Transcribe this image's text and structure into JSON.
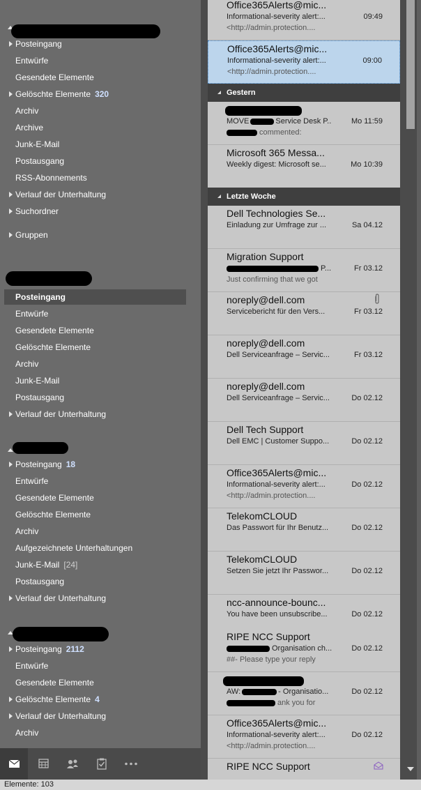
{
  "sidebar": {
    "account1": {
      "folders": [
        {
          "label": "Posteingang",
          "arrow": "collapsed",
          "count": ""
        },
        {
          "label": "Entwürfe",
          "arrow": "",
          "count": ""
        },
        {
          "label": "Gesendete Elemente",
          "arrow": "",
          "count": ""
        },
        {
          "label": "Gelöschte Elemente",
          "arrow": "collapsed",
          "count": "320"
        },
        {
          "label": "Archiv",
          "arrow": "",
          "count": ""
        },
        {
          "label": "Archive",
          "arrow": "",
          "count": ""
        },
        {
          "label": "Junk-E-Mail",
          "arrow": "",
          "count": ""
        },
        {
          "label": "Postausgang",
          "arrow": "",
          "count": ""
        },
        {
          "label": "RSS-Abonnements",
          "arrow": "",
          "count": ""
        },
        {
          "label": "Verlauf der Unterhaltung",
          "arrow": "collapsed",
          "count": ""
        },
        {
          "label": "Suchordner",
          "arrow": "collapsed",
          "count": ""
        }
      ],
      "groups": "Gruppen"
    },
    "account2": {
      "folders": [
        {
          "label": "Posteingang",
          "selected": true
        },
        {
          "label": "Entwürfe"
        },
        {
          "label": "Gesendete Elemente"
        },
        {
          "label": "Gelöschte Elemente"
        },
        {
          "label": "Archiv"
        },
        {
          "label": "Junk-E-Mail"
        },
        {
          "label": "Postausgang"
        },
        {
          "label": "Verlauf der Unterhaltung"
        }
      ]
    },
    "account3": {
      "folders": [
        {
          "label": "Posteingang",
          "count": "18"
        },
        {
          "label": "Entwürfe"
        },
        {
          "label": "Gesendete Elemente"
        },
        {
          "label": "Gelöschte Elemente"
        },
        {
          "label": "Archiv"
        },
        {
          "label": "Aufgezeichnete Unterhaltungen"
        },
        {
          "label": "Junk-E-Mail",
          "count": "[24]"
        },
        {
          "label": "Postausgang"
        },
        {
          "label": "Verlauf der Unterhaltung"
        }
      ]
    },
    "account4": {
      "folders": [
        {
          "label": "Posteingang",
          "count": "2112"
        },
        {
          "label": "Entwürfe"
        },
        {
          "label": "Gesendete Elemente"
        },
        {
          "label": "Gelöschte Elemente",
          "count": "4"
        },
        {
          "label": "Verlauf der Unterhaltung"
        },
        {
          "label": "Archiv"
        }
      ]
    }
  },
  "navbar": {
    "icons": [
      "mail-icon",
      "calendar-icon",
      "people-icon",
      "tasks-icon",
      "more-icon"
    ]
  },
  "status": {
    "label": "Elemente: 103"
  },
  "mail_list": {
    "groups": {
      "yesterday": "Gestern",
      "last_week": "Letzte Woche"
    },
    "items": [
      {
        "from": "Office365Alerts@mic...",
        "subject": "Informational-severity alert:...",
        "preview": "<http://admin.protection....",
        "date": "09:49"
      },
      {
        "from": "Office365Alerts@mic...",
        "subject": "Informational-severity alert:...",
        "preview": "<http://admin.protection....",
        "date": "09:00"
      },
      {
        "from": "",
        "subject": "MOVE",
        "subject_tail": "Service Desk P...",
        "preview": "commented:",
        "date": "Mo 11:59"
      },
      {
        "from": "Microsoft 365 Messa...",
        "subject": "Weekly digest: Microsoft se...",
        "preview": "",
        "date": "Mo 10:39"
      },
      {
        "from": "Dell Technologies Se...",
        "subject": "Einladung zur Umfrage zur ...",
        "preview": "",
        "date": "Sa 04.12"
      },
      {
        "from": "Migration Support",
        "subject": "P...",
        "preview": "Just confirming that we got",
        "date": "Fr 03.12"
      },
      {
        "from": "noreply@dell.com",
        "subject": "Servicebericht für den Vers...",
        "preview": "",
        "date": "Fr 03.12"
      },
      {
        "from": "noreply@dell.com",
        "subject": "Dell Serviceanfrage – Servic...",
        "preview": "",
        "date": "Fr 03.12"
      },
      {
        "from": "noreply@dell.com",
        "subject": "Dell Serviceanfrage – Servic...",
        "preview": "",
        "date": "Do 02.12"
      },
      {
        "from": "Dell Tech Support",
        "subject": "Dell EMC | Customer Suppo...",
        "preview": "",
        "date": "Do 02.12"
      },
      {
        "from": "Office365Alerts@mic...",
        "subject": "Informational-severity alert:...",
        "preview": "<http://admin.protection....",
        "date": "Do 02.12"
      },
      {
        "from": "TelekomCLOUD",
        "subject": "Das Passwort für Ihr Benutz...",
        "preview": "",
        "date": "Do 02.12"
      },
      {
        "from": "TelekomCLOUD",
        "subject": "Setzen Sie jetzt Ihr Passwor...",
        "preview": "",
        "date": "Do 02.12"
      },
      {
        "from": "ncc-announce-bounc...",
        "subject": "You have been unsubscribe...",
        "preview": "",
        "date": "Do 02.12"
      },
      {
        "from": "RIPE NCC Support",
        "subject": "Organisation ch...",
        "preview": "##- Please type your reply",
        "date": "Do 02.12"
      },
      {
        "from": "",
        "subject": "AW:",
        "subject_tail": "- Organisatio...",
        "preview": "ank you for",
        "date": "Do 02.12"
      },
      {
        "from": "Office365Alerts@mic...",
        "subject": "Informational-severity alert:...",
        "preview": "<http://admin.protection....",
        "date": "Do 02.12"
      },
      {
        "from": "RIPE NCC Support",
        "subject": "",
        "preview": "",
        "date": ""
      }
    ]
  }
}
